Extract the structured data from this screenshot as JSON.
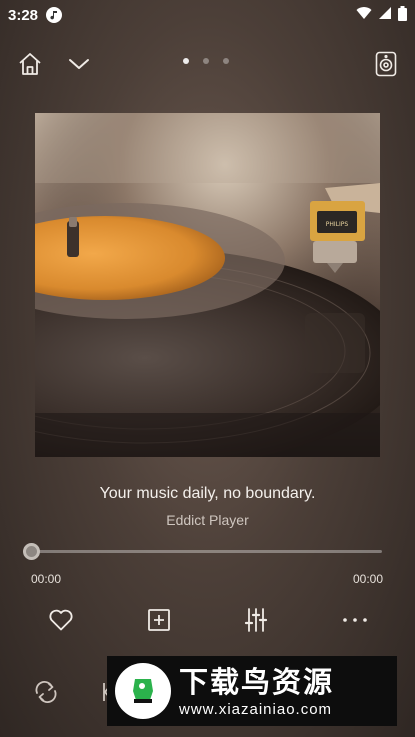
{
  "status_bar": {
    "time": "3:28",
    "app_icon": "music-note-icon",
    "icons": [
      "wifi-icon",
      "signal-icon",
      "battery-icon"
    ]
  },
  "top_bar": {
    "home_icon": "home-icon",
    "collapse_icon": "chevron-down-icon",
    "page_indicator": {
      "count": 3,
      "active": 0
    },
    "speaker_icon": "speaker-icon"
  },
  "album": {
    "description_icon": "album-art-image"
  },
  "track": {
    "title": "Your music daily, no boundary.",
    "artist": "Eddict Player"
  },
  "progress": {
    "current_time": "00:00",
    "total_time": "00:00",
    "fraction": 0.0
  },
  "actions": {
    "favorite_icon": "heart-icon",
    "add_playlist_icon": "add-to-playlist-icon",
    "equalizer_icon": "equalizer-icon",
    "more_icon": "more-icon"
  },
  "controls": {
    "repeat_icon": "repeat-icon",
    "previous_icon": "skip-previous-icon"
  },
  "watermark": {
    "title": "下载鸟资源",
    "url": "www.xiazainiao.com"
  },
  "colors": {
    "background": "#4c3f38",
    "text_primary": "#f4f0ec",
    "text_secondary": "#cfc6bf",
    "watermark_bg": "#0d0d0d"
  }
}
